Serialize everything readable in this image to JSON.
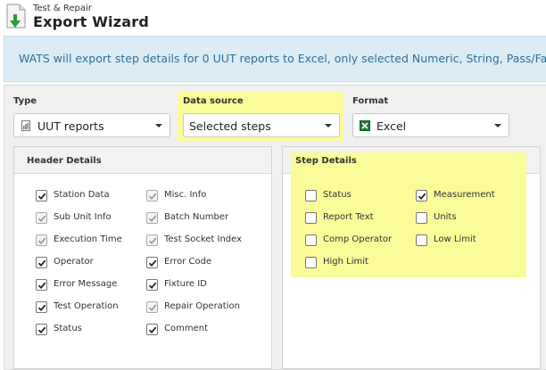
{
  "header": {
    "subtitle": "Test & Repair",
    "title": "Export Wizard"
  },
  "banner": {
    "text": "WATS will export step details for 0 UUT reports to Excel, only selected Numeric, String, Pass/Fail a"
  },
  "type_field": {
    "label": "Type",
    "value": "UUT reports",
    "icon": "report-icon"
  },
  "datasource_field": {
    "label": "Data source",
    "value": "Selected steps"
  },
  "format_field": {
    "label": "Format",
    "value": "Excel",
    "icon": "excel-icon"
  },
  "header_details": {
    "title": "Header Details",
    "col1": [
      {
        "label": "Station Data",
        "checked": true,
        "disabled": false
      },
      {
        "label": "Sub Unit Info",
        "checked": true,
        "disabled": true
      },
      {
        "label": "Execution Time",
        "checked": true,
        "disabled": true
      },
      {
        "label": "Operator",
        "checked": true,
        "disabled": false
      },
      {
        "label": "Error Message",
        "checked": true,
        "disabled": false
      },
      {
        "label": "Test Operation",
        "checked": true,
        "disabled": false
      },
      {
        "label": "Status",
        "checked": true,
        "disabled": false
      }
    ],
    "col2": [
      {
        "label": "Misc. Info",
        "checked": true,
        "disabled": true
      },
      {
        "label": "Batch Number",
        "checked": true,
        "disabled": true
      },
      {
        "label": "Test Socket Index",
        "checked": true,
        "disabled": true
      },
      {
        "label": "Error Code",
        "checked": true,
        "disabled": false
      },
      {
        "label": "Fixture ID",
        "checked": true,
        "disabled": false
      },
      {
        "label": "Repair Operation",
        "checked": true,
        "disabled": true
      },
      {
        "label": "Comment",
        "checked": true,
        "disabled": false
      }
    ]
  },
  "step_details": {
    "title": "Step Details",
    "col1": [
      {
        "label": "Status",
        "checked": false
      },
      {
        "label": "Report Text",
        "checked": false
      },
      {
        "label": "Comp Operator",
        "checked": false
      },
      {
        "label": "High Limit",
        "checked": false
      }
    ],
    "col2": [
      {
        "label": "Measurement",
        "checked": true
      },
      {
        "label": "Units",
        "checked": false
      },
      {
        "label": "Low Limit",
        "checked": false
      }
    ]
  },
  "colors": {
    "highlight": "#fbfb9a",
    "banner_bg": "#dcecf5",
    "banner_text": "#2d6f97"
  }
}
